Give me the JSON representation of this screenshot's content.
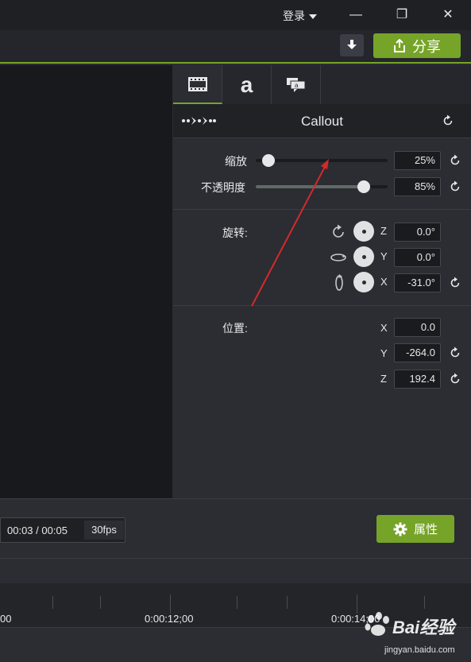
{
  "titlebar": {
    "login_label": "登录",
    "minimize": "—",
    "restore": "❐",
    "close": "✕"
  },
  "toolbar": {
    "share_label": "分享"
  },
  "panel": {
    "tabs": [
      {
        "icon": "film-icon"
      },
      {
        "label": "a",
        "icon": "text-icon"
      },
      {
        "icon": "callout-icon"
      }
    ],
    "header_title": "Callout",
    "scale": {
      "label": "缩放",
      "value": "25%",
      "level": 0.05
    },
    "opacity": {
      "label": "不透明度",
      "value": "85%",
      "level": 0.85
    },
    "rotation": {
      "label": "旋转:",
      "z": {
        "axis": "Z",
        "value": "0.0°"
      },
      "y": {
        "axis": "Y",
        "value": "0.0°"
      },
      "x": {
        "axis": "X",
        "value": "-31.0°"
      }
    },
    "position": {
      "label": "位置:",
      "x": {
        "axis": "X",
        "value": "0.0"
      },
      "y": {
        "axis": "Y",
        "value": "-264.0"
      },
      "z": {
        "axis": "Z",
        "value": "192.4"
      }
    }
  },
  "playback": {
    "time_current": "00:03",
    "time_sep": "/",
    "time_total": "00:05",
    "fps": "30fps",
    "properties_label": "属性"
  },
  "timeline": {
    "labels": [
      "00",
      "0:00:12;00",
      "0:00:14;00"
    ]
  },
  "watermark": {
    "brand": "Bai经验",
    "url": "jingyan.baidu.com"
  },
  "colors": {
    "accent": "#76a428",
    "annotation_arrow": "#d4292b"
  }
}
